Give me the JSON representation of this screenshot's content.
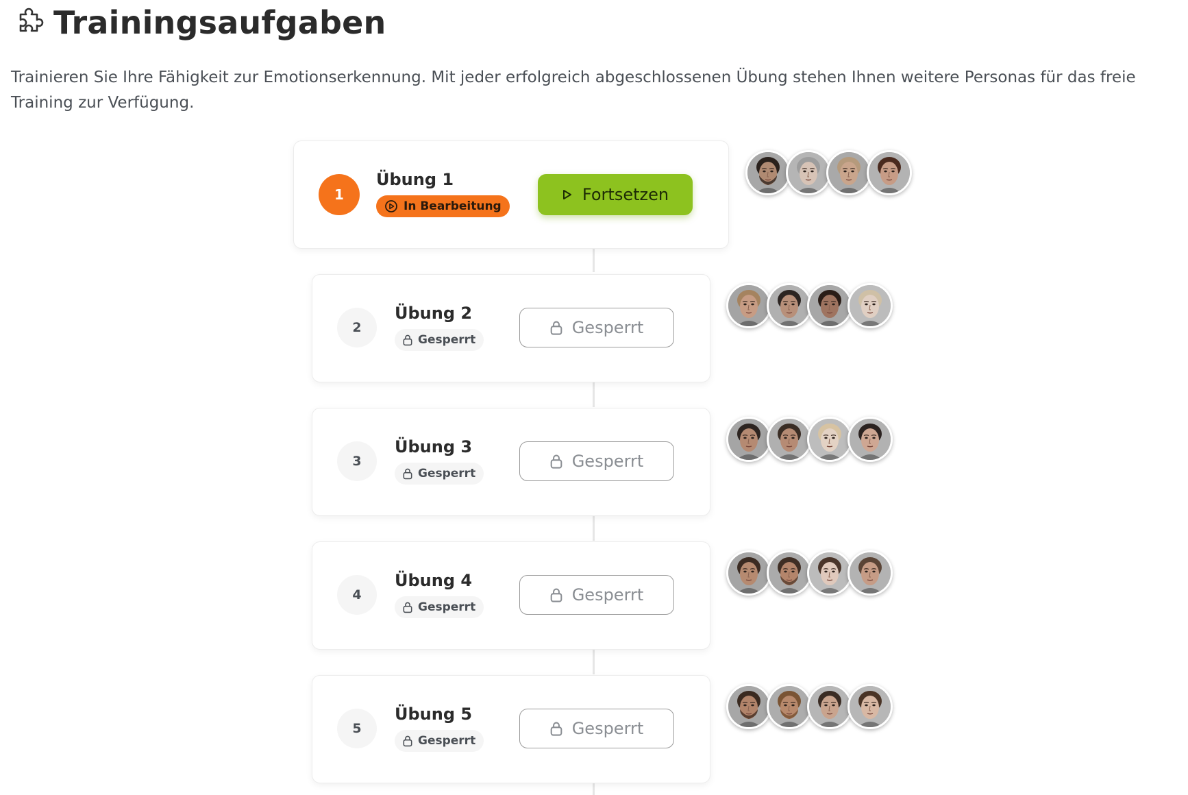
{
  "header": {
    "icon": "puzzle-icon",
    "title": "Trainingsaufgaben"
  },
  "intro": "Trainieren Sie Ihre Fähigkeit zur Emotionserkennung. Mit jeder erfolgreich abgeschlossenen Übung stehen Ihnen weitere Personas für das freie Training zur Verfügung.",
  "colors": {
    "accent_orange": "#f5731b",
    "accent_green": "#8dc21f"
  },
  "exercises": [
    {
      "number": "1",
      "title": "Übung 1",
      "status": "In Bearbeitung",
      "status_icon": "play-circle-icon",
      "button_label": "Fortsetzen",
      "button_icon": "play-icon",
      "personas": [
        {
          "skin": "#b08a72",
          "hair": "#2a211c",
          "bg": "#a7a7a7",
          "beard": "#3a2c24"
        },
        {
          "skin": "#d7c3b6",
          "hair": "#9d9d9d",
          "bg": "#b5b5b5",
          "beard": ""
        },
        {
          "skin": "#c9a58c",
          "hair": "#b59a7c",
          "bg": "#a9a9a9",
          "beard": ""
        },
        {
          "skin": "#c79c86",
          "hair": "#4a2a1e",
          "bg": "#b3b3b3",
          "beard": ""
        }
      ]
    },
    {
      "number": "2",
      "title": "Übung 2",
      "status": "Gesperrt",
      "status_icon": "lock-icon",
      "button_label": "Gesperrt",
      "button_icon": "lock-icon",
      "personas": [
        {
          "skin": "#c79c84",
          "hair": "#a5835f",
          "bg": "#a4a4a4",
          "beard": ""
        },
        {
          "skin": "#b8907a",
          "hair": "#2c2522",
          "bg": "#b0b0b0",
          "beard": ""
        },
        {
          "skin": "#9f7460",
          "hair": "#2a1d17",
          "bg": "#a7a7a7",
          "beard": ""
        },
        {
          "skin": "#e0cfc3",
          "hair": "#cfc0a6",
          "bg": "#bcbcbc",
          "beard": ""
        }
      ]
    },
    {
      "number": "3",
      "title": "Übung 3",
      "status": "Gesperrt",
      "status_icon": "lock-icon",
      "button_label": "Gesperrt",
      "button_icon": "lock-icon",
      "personas": [
        {
          "skin": "#b58a72",
          "hair": "#2d2420",
          "bg": "#a5a5a5",
          "beard": ""
        },
        {
          "skin": "#b68b74",
          "hair": "#3a2d25",
          "bg": "#b0b0b0",
          "beard": ""
        },
        {
          "skin": "#e3d2c4",
          "hair": "#d7c3a2",
          "bg": "#bdbdbd",
          "beard": ""
        },
        {
          "skin": "#cfa793",
          "hair": "#2b2220",
          "bg": "#b2b2b2",
          "beard": ""
        }
      ]
    },
    {
      "number": "4",
      "title": "Übung 4",
      "status": "Gesperrt",
      "status_icon": "lock-icon",
      "button_label": "Gesperrt",
      "button_icon": "lock-icon",
      "personas": [
        {
          "skin": "#b68a70",
          "hair": "#3b2b22",
          "bg": "#a5a5a5",
          "beard": ""
        },
        {
          "skin": "#b4856b",
          "hair": "#3f2e24",
          "bg": "#ababab",
          "beard": "#5a4030"
        },
        {
          "skin": "#e0c9bc",
          "hair": "#4a352a",
          "bg": "#bcbcbc",
          "beard": ""
        },
        {
          "skin": "#c69c86",
          "hair": "#5a4436",
          "bg": "#b3b3b3",
          "beard": ""
        }
      ]
    },
    {
      "number": "5",
      "title": "Übung 5",
      "status": "Gesperrt",
      "status_icon": "lock-icon",
      "button_label": "Gesperrt",
      "button_icon": "lock-icon",
      "personas": [
        {
          "skin": "#b2846a",
          "hair": "#3a2a20",
          "bg": "#a7a7a7",
          "beard": "#4a3226"
        },
        {
          "skin": "#b8896c",
          "hair": "#7a5434",
          "bg": "#adadad",
          "beard": "#7a5434"
        },
        {
          "skin": "#c9a48e",
          "hair": "#3a2c24",
          "bg": "#b6b6b6",
          "beard": ""
        },
        {
          "skin": "#d8b8a4",
          "hair": "#4a3426",
          "bg": "#b7b7b7",
          "beard": ""
        }
      ]
    }
  ]
}
